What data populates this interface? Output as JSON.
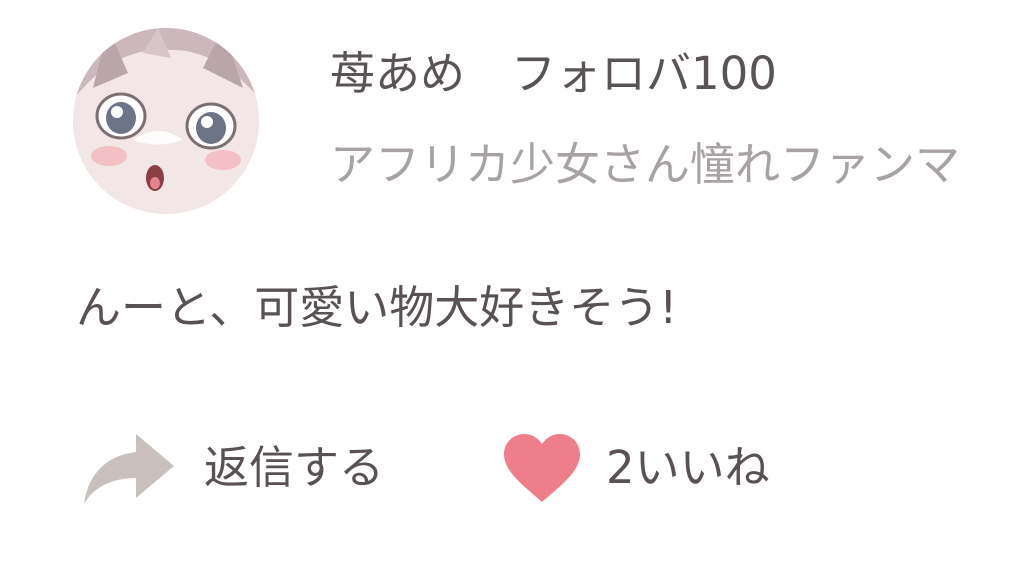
{
  "user": {
    "name": "苺あめ",
    "follower_label": "フォロバ100",
    "bio": "アフリカ少女さん憧れファンマ"
  },
  "comment": {
    "text": "んーと、可愛い物大好きそう!"
  },
  "actions": {
    "reply_label": "返信する",
    "like_label": "2いいね"
  },
  "icons": {
    "reply": "share-arrow-icon",
    "like": "heart-icon"
  },
  "colors": {
    "text": "#595152",
    "muted_text": "#a8a2a3",
    "reply_icon": "#c9c0bd",
    "heart": "#ee7f8a"
  }
}
